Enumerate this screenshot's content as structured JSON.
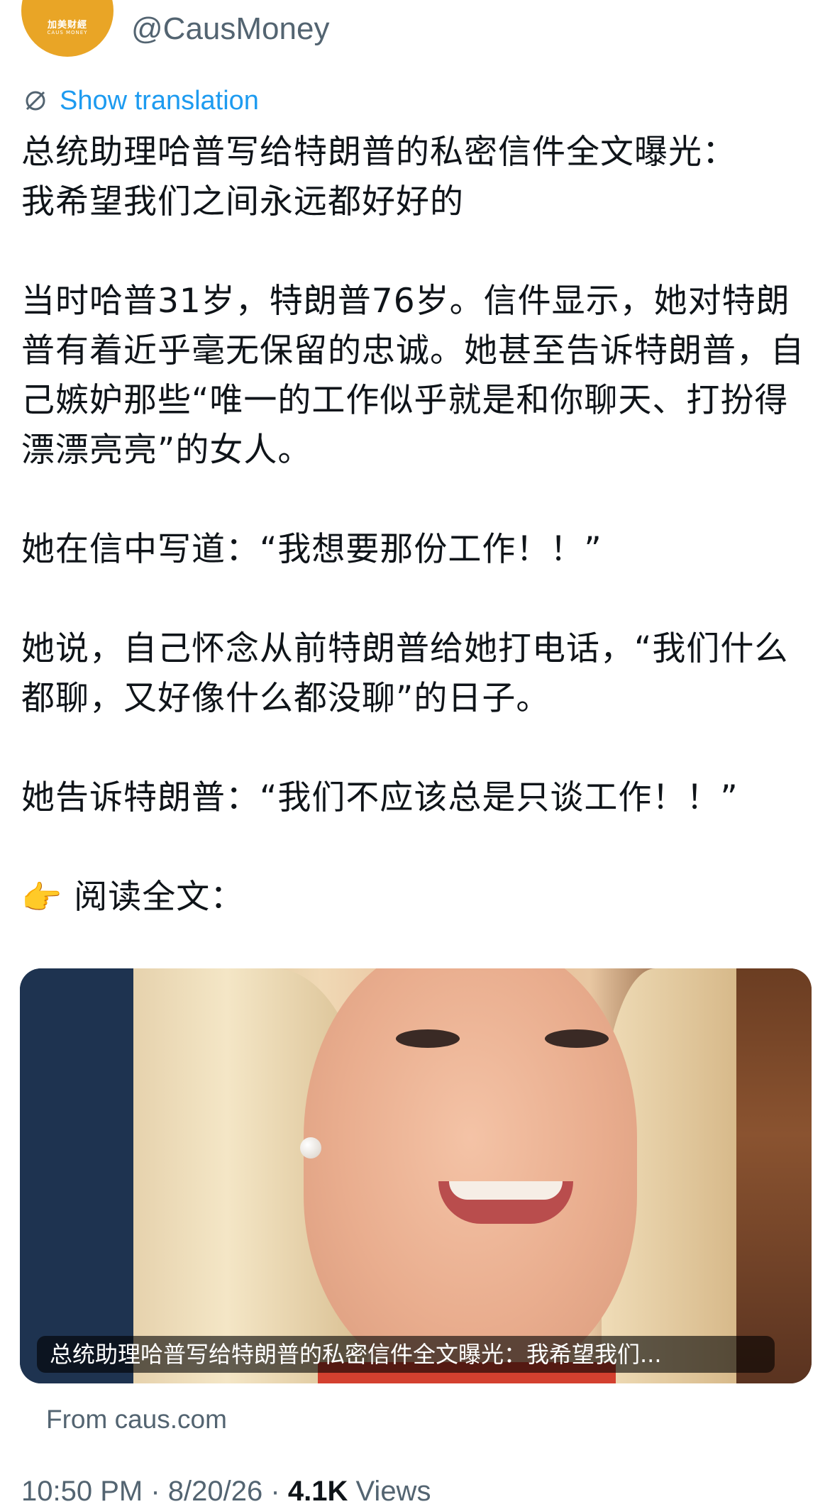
{
  "header": {
    "avatar_cn": "加美财經",
    "avatar_en": "CAUS MONEY",
    "handle": "@CausMoney"
  },
  "translate": {
    "label": "Show translation"
  },
  "tweet": {
    "line1": "总统助理哈普写给特朗普的私密信件全文曝光：",
    "line2": "我希望我们之间永远都好好的",
    "para2": "当时哈普31岁，特朗普76岁。信件显示，她对特朗普有着近乎毫无保留的忠诚。她甚至告诉特朗普，自己嫉妒那些“唯一的工作似乎就是和你聊天、打扮得漂漂亮亮”的女人。",
    "para3": "她在信中写道：“我想要那份工作！！”",
    "para4": "她说，自己怀念从前特朗普给她打电话，“我们什么都聊，又好像什么都没聊”的日子。",
    "para5": "她告诉特朗普：“我们不应该总是只谈工作！！”",
    "read_emoji": "👉",
    "read_label": "阅读全文："
  },
  "card": {
    "caption": "总统助理哈普写给特朗普的私密信件全文曝光：我希望我们..."
  },
  "source": "From caus.com",
  "meta": {
    "time": "10:50 PM",
    "date": "8/20/26",
    "separator": "·",
    "views_count": "4.1K",
    "views_label": "Views"
  },
  "colors": {
    "link": "#1d9bf0",
    "secondary_text": "#536471",
    "avatar": "#e9a526"
  }
}
